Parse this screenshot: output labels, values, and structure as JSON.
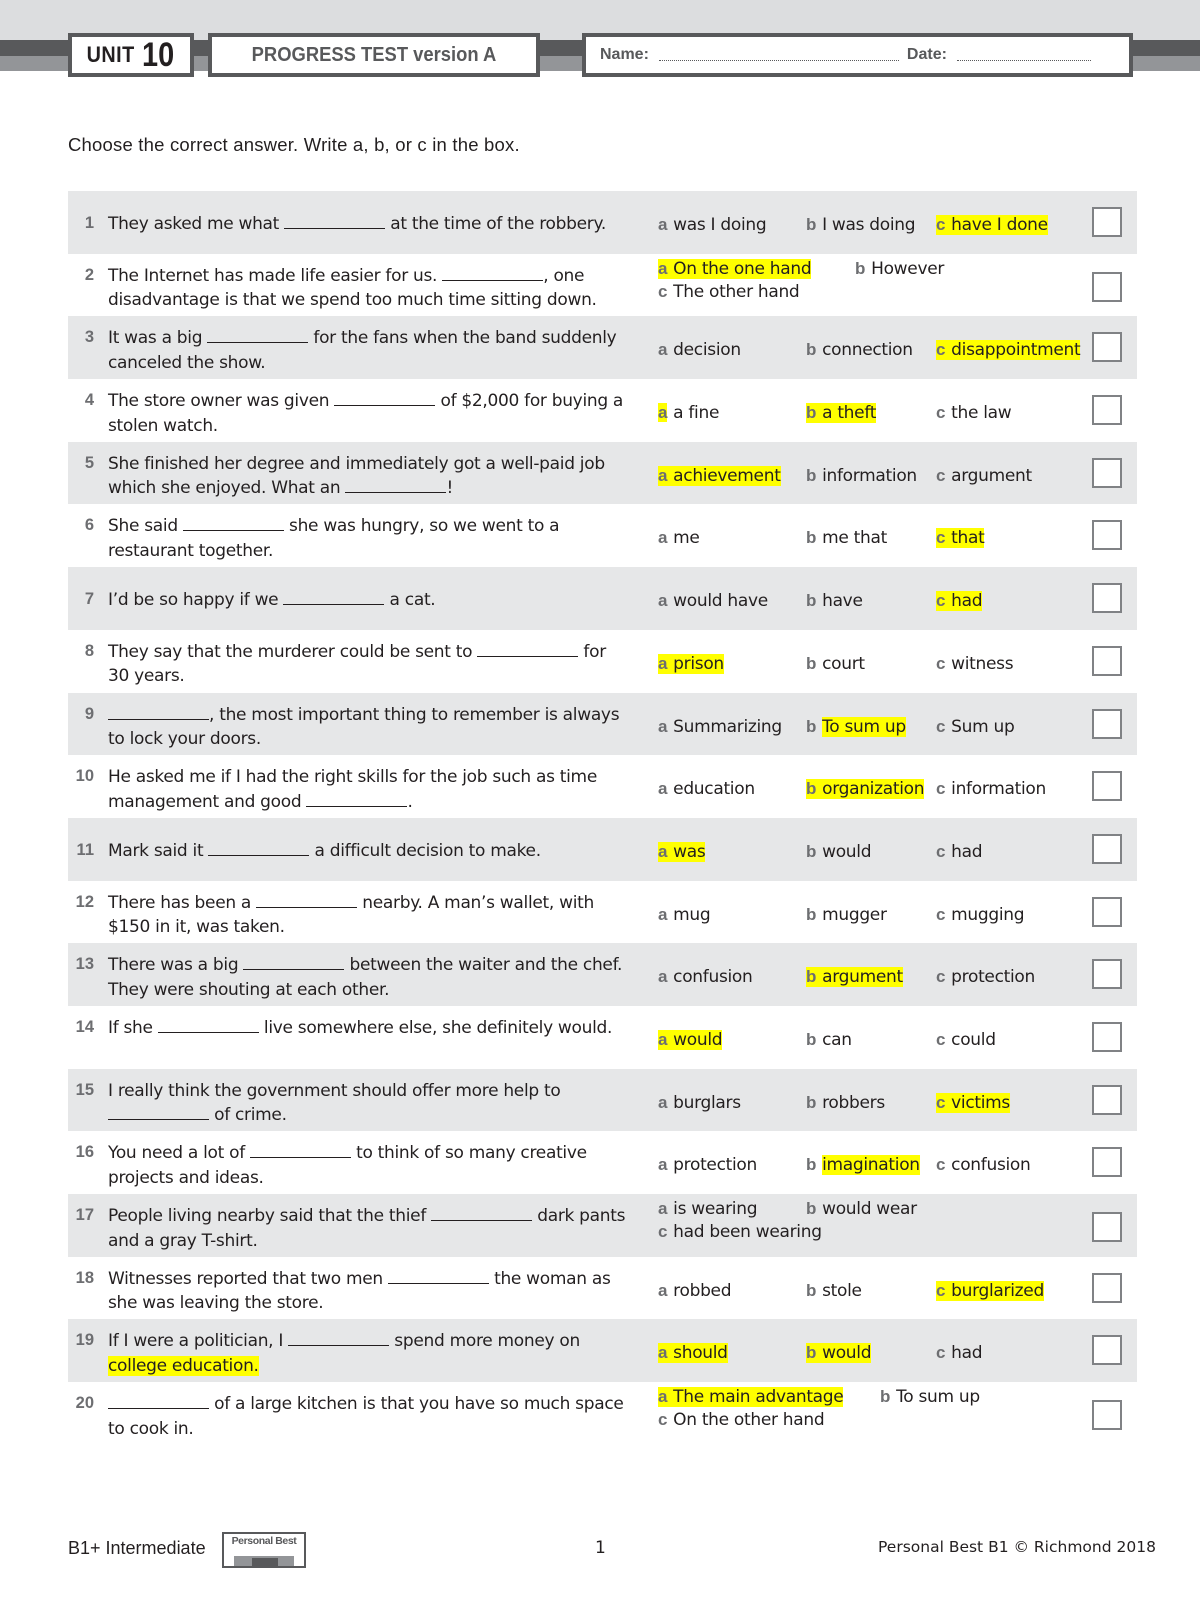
{
  "header": {
    "unit_label": "UNIT",
    "unit_number": "10",
    "test_title": "PROGRESS TEST version A",
    "name_label": "Name:",
    "date_label": "Date:"
  },
  "instruction": "Choose the correct answer. Write a, b, or c in the box.",
  "colors": {
    "highlight": "#ffff00",
    "row_shade": "#e6e7e8",
    "header_dark": "#58595b",
    "header_light": "#939598"
  },
  "questions": [
    {
      "num": "1",
      "parts": [
        "They asked me what ",
        "BLANK",
        " at the time of the robbery."
      ],
      "options": [
        {
          "letter": "a",
          "text": "was I doing",
          "highlighted": false
        },
        {
          "letter": "b",
          "text": "I was doing",
          "highlighted": false
        },
        {
          "letter": "c",
          "text": "have I done",
          "highlighted": true
        }
      ],
      "answer": ""
    },
    {
      "num": "2",
      "parts": [
        "The Internet has made life easier for us. ",
        "BLANK",
        ", one disadvantage is that we spend too much time sitting down."
      ],
      "options": [
        {
          "letter": "a",
          "text": "On the one hand",
          "highlighted": true
        },
        {
          "letter": "b",
          "text": "However",
          "highlighted": false
        },
        {
          "letter": "c",
          "text": "The other hand",
          "highlighted": false
        }
      ],
      "answer": ""
    },
    {
      "num": "3",
      "parts": [
        "It was a big ",
        "BLANK",
        " for the fans when the band suddenly canceled the show."
      ],
      "options": [
        {
          "letter": "a",
          "text": "decision",
          "highlighted": false
        },
        {
          "letter": "b",
          "text": "connection",
          "highlighted": false
        },
        {
          "letter": "c",
          "text": "disappointment",
          "highlighted": true
        }
      ],
      "answer": ""
    },
    {
      "num": "4",
      "parts": [
        "The store owner was given ",
        "BLANK",
        " of $2,000 for buying a stolen watch."
      ],
      "options": [
        {
          "letter": "a",
          "text": "a fine",
          "highlighted": "letter"
        },
        {
          "letter": "b",
          "text": "a theft",
          "highlighted": true
        },
        {
          "letter": "c",
          "text": "the law",
          "highlighted": false
        }
      ],
      "answer": ""
    },
    {
      "num": "5",
      "parts": [
        "She finished her degree and immediately got a well-paid job which she enjoyed. What an ",
        "BLANK",
        "!"
      ],
      "options": [
        {
          "letter": "a",
          "text": "achievement",
          "highlighted": true
        },
        {
          "letter": "b",
          "text": "information",
          "highlighted": false
        },
        {
          "letter": "c",
          "text": "argument",
          "highlighted": false
        }
      ],
      "answer": ""
    },
    {
      "num": "6",
      "parts": [
        "She said ",
        "BLANK",
        " she was hungry, so we went to a restaurant together."
      ],
      "options": [
        {
          "letter": "a",
          "text": "me",
          "highlighted": false
        },
        {
          "letter": "b",
          "text": "me that",
          "highlighted": false
        },
        {
          "letter": "c",
          "text": "that",
          "highlighted": true
        }
      ],
      "answer": ""
    },
    {
      "num": "7",
      "parts": [
        "I’d be so happy if we ",
        "BLANK",
        " a cat."
      ],
      "options": [
        {
          "letter": "a",
          "text": "would have",
          "highlighted": false
        },
        {
          "letter": "b",
          "text": "have",
          "highlighted": false
        },
        {
          "letter": "c",
          "text": "had",
          "highlighted": true
        }
      ],
      "answer": ""
    },
    {
      "num": "8",
      "parts": [
        "They say that the murderer could be sent to ",
        "BLANK",
        " for 30 years."
      ],
      "options": [
        {
          "letter": "a",
          "text": "prison",
          "highlighted": true
        },
        {
          "letter": "b",
          "text": "court",
          "highlighted": false
        },
        {
          "letter": "c",
          "text": "witness",
          "highlighted": false
        }
      ],
      "answer": ""
    },
    {
      "num": "9",
      "parts": [
        "",
        "BLANK",
        ", the most important thing to remember is always to lock your doors."
      ],
      "options": [
        {
          "letter": "a",
          "text": "Summarizing",
          "highlighted": false
        },
        {
          "letter": "b",
          "text": "To sum up",
          "highlighted": "text"
        },
        {
          "letter": "c",
          "text": "Sum up",
          "highlighted": false
        }
      ],
      "answer": ""
    },
    {
      "num": "10",
      "parts": [
        "He asked me if I had the right skills for the job such as time management and good ",
        "BLANK",
        "."
      ],
      "options": [
        {
          "letter": "a",
          "text": "education",
          "highlighted": false
        },
        {
          "letter": "b",
          "text": "organization",
          "highlighted": true
        },
        {
          "letter": "c",
          "text": "information",
          "highlighted": false
        }
      ],
      "answer": ""
    },
    {
      "num": "11",
      "parts": [
        "Mark said it ",
        "BLANK",
        " a difficult decision to make."
      ],
      "options": [
        {
          "letter": "a",
          "text": "was",
          "highlighted": true
        },
        {
          "letter": "b",
          "text": "would",
          "highlighted": false
        },
        {
          "letter": "c",
          "text": "had",
          "highlighted": false
        }
      ],
      "answer": ""
    },
    {
      "num": "12",
      "parts": [
        "There has been a ",
        "BLANK",
        " nearby. A man’s wallet, with $150 in it, was taken."
      ],
      "options": [
        {
          "letter": "a",
          "text": "mug",
          "highlighted": false
        },
        {
          "letter": "b",
          "text": "mugger",
          "highlighted": false
        },
        {
          "letter": "c",
          "text": "mugging",
          "highlighted": false
        }
      ],
      "answer": ""
    },
    {
      "num": "13",
      "parts": [
        "There was a big ",
        "BLANK",
        " between the waiter and the chef. They were shouting at each other."
      ],
      "options": [
        {
          "letter": "a",
          "text": "confusion",
          "highlighted": false
        },
        {
          "letter": "b",
          "text": "argument",
          "highlighted": true
        },
        {
          "letter": "c",
          "text": "protection",
          "highlighted": false
        }
      ],
      "answer": ""
    },
    {
      "num": "14",
      "parts": [
        "If she ",
        "BLANK",
        " live somewhere else, she definitely would."
      ],
      "options": [
        {
          "letter": "a",
          "text": "would",
          "highlighted": true
        },
        {
          "letter": "b",
          "text": "can",
          "highlighted": false
        },
        {
          "letter": "c",
          "text": "could",
          "highlighted": false
        }
      ],
      "answer": ""
    },
    {
      "num": "15",
      "parts": [
        "I really think the government should offer more help to ",
        "BLANK",
        " of crime."
      ],
      "options": [
        {
          "letter": "a",
          "text": "burglars",
          "highlighted": false
        },
        {
          "letter": "b",
          "text": "robbers",
          "highlighted": false
        },
        {
          "letter": "c",
          "text": "victims",
          "highlighted": true
        }
      ],
      "answer": ""
    },
    {
      "num": "16",
      "parts": [
        "You need a lot of ",
        "BLANK",
        " to think of so many creative projects and ideas."
      ],
      "options": [
        {
          "letter": "a",
          "text": "protection",
          "highlighted": false
        },
        {
          "letter": "b",
          "text": "imagination",
          "highlighted": "text"
        },
        {
          "letter": "c",
          "text": "confusion",
          "highlighted": false
        }
      ],
      "answer": ""
    },
    {
      "num": "17",
      "parts": [
        "People living nearby said that the thief ",
        "BLANK",
        " dark pants and a gray T-shirt."
      ],
      "options": [
        {
          "letter": "a",
          "text": "is wearing",
          "highlighted": false
        },
        {
          "letter": "b",
          "text": "would wear",
          "highlighted": false
        },
        {
          "letter": "c",
          "text": "had been wearing",
          "highlighted": false
        }
      ],
      "answer": ""
    },
    {
      "num": "18",
      "parts": [
        "Witnesses reported that two men ",
        "BLANK",
        " the woman as she was leaving the store."
      ],
      "options": [
        {
          "letter": "a",
          "text": "robbed",
          "highlighted": false
        },
        {
          "letter": "b",
          "text": "stole",
          "highlighted": false
        },
        {
          "letter": "c",
          "text": "burglarized",
          "highlighted": true
        }
      ],
      "answer": ""
    },
    {
      "num": "19",
      "parts": [
        "If I were a politician, I ",
        "BLANK",
        " spend more money on ",
        "HL:college education."
      ],
      "options": [
        {
          "letter": "a",
          "text": "should",
          "highlighted": true
        },
        {
          "letter": "b",
          "text": "would",
          "highlighted": true
        },
        {
          "letter": "c",
          "text": "had",
          "highlighted": false
        }
      ],
      "answer": ""
    },
    {
      "num": "20",
      "parts": [
        "",
        "BLANK",
        " of a large kitchen is that you have so much space to cook in."
      ],
      "options": [
        {
          "letter": "a",
          "text": "The main advantage",
          "highlighted": true
        },
        {
          "letter": "b",
          "text": "To sum up",
          "highlighted": false
        },
        {
          "letter": "c",
          "text": "On the other hand",
          "highlighted": false
        }
      ],
      "answer": ""
    }
  ],
  "footer": {
    "level": "B1+ Intermediate",
    "logo_text": "Personal Best",
    "page_number": "1",
    "copyright": "Personal Best B1 © Richmond 2018"
  }
}
